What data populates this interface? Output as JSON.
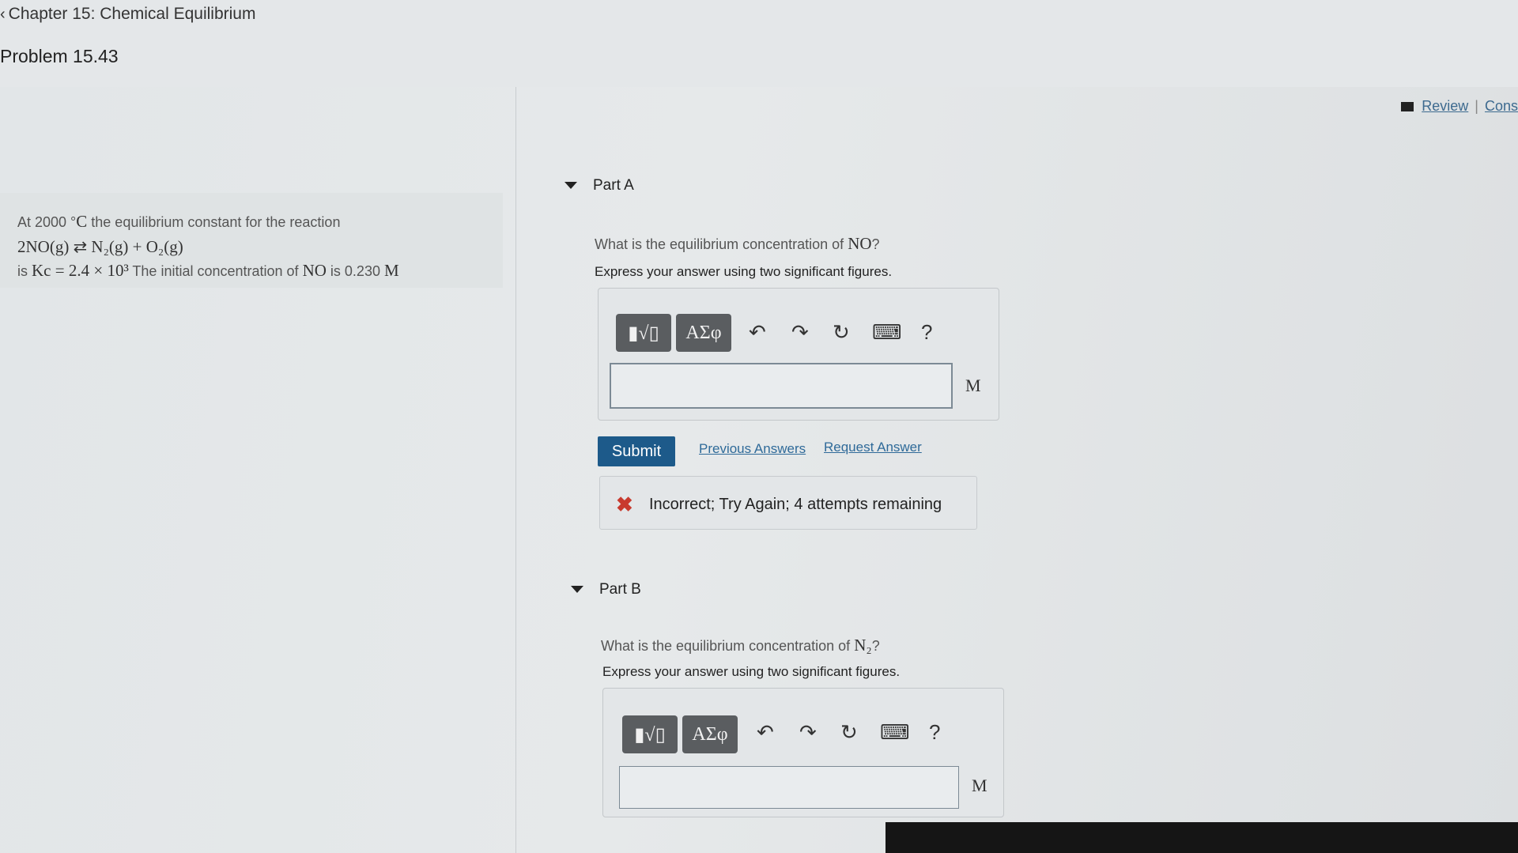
{
  "header": {
    "back_link": "Chapter 15: Chemical Equilibrium",
    "problem_title": "Problem 15.43",
    "review_link": "Review",
    "constants_link": "Cons"
  },
  "statement": {
    "line1_text": "At 2000 °",
    "line1_math": "C",
    "line1_rest": "the equilibrium constant for the reaction",
    "reaction": "2NO(g) ⇄ N₂(g) + O₂(g)",
    "line3_prefix": "is",
    "kc": "Kc = 2.4 × 10³",
    "line3_mid": "The initial concentration of",
    "no": "NO",
    "line3_is": "is 0.230",
    "unit": "M"
  },
  "partA": {
    "header": "Part A",
    "question_prefix": "What is the equilibrium concentration of",
    "question_species": "NO",
    "question_suffix": "?",
    "instruction": "Express your answer using two significant figures.",
    "toolbar": {
      "templates": "▮√▯",
      "symbols": "ΑΣφ",
      "undo": "↶",
      "redo": "↷",
      "reset": "↻",
      "keyboard": "⌨",
      "help": "?"
    },
    "input_value": "",
    "unit": "M",
    "submit_label": "Submit",
    "previous_answers": "Previous Answers",
    "request_answer": "Request Answer",
    "feedback": "Incorrect; Try Again; 4 attempts remaining",
    "feedback_icon": "✖"
  },
  "partB": {
    "header": "Part B",
    "question_prefix": "What is the equilibrium concentration of",
    "question_species": "N₂",
    "question_suffix": "?",
    "instruction": "Express your answer using two significant figures.",
    "toolbar": {
      "templates": "▮√▯",
      "symbols": "ΑΣφ",
      "undo": "↶",
      "redo": "↷",
      "reset": "↻",
      "keyboard": "⌨",
      "help": "?"
    },
    "input_value": "",
    "unit": "M"
  },
  "colors": {
    "submit": "#1d5a8a",
    "link": "#2f6a99",
    "error": "#c83a2e",
    "toolbar_button": "#5a5d60"
  }
}
